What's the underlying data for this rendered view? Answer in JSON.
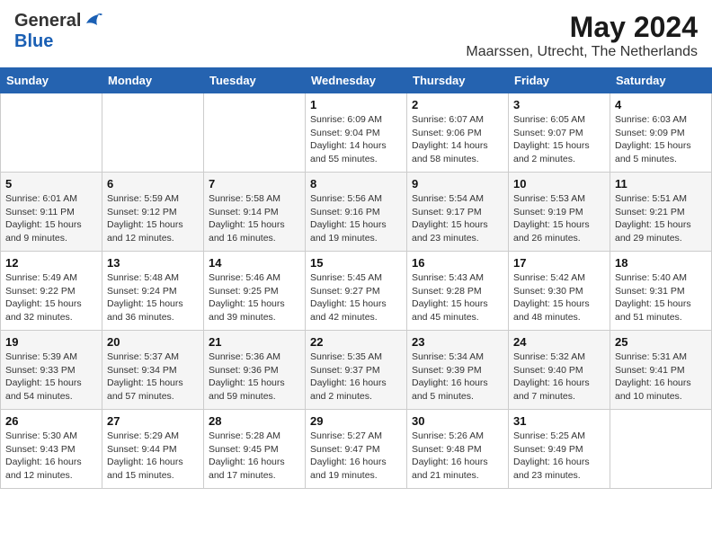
{
  "header": {
    "logo_general": "General",
    "logo_blue": "Blue",
    "month": "May 2024",
    "location": "Maarssen, Utrecht, The Netherlands"
  },
  "days_of_week": [
    "Sunday",
    "Monday",
    "Tuesday",
    "Wednesday",
    "Thursday",
    "Friday",
    "Saturday"
  ],
  "weeks": [
    [
      {
        "day": "",
        "info": ""
      },
      {
        "day": "",
        "info": ""
      },
      {
        "day": "",
        "info": ""
      },
      {
        "day": "1",
        "info": "Sunrise: 6:09 AM\nSunset: 9:04 PM\nDaylight: 14 hours\nand 55 minutes."
      },
      {
        "day": "2",
        "info": "Sunrise: 6:07 AM\nSunset: 9:06 PM\nDaylight: 14 hours\nand 58 minutes."
      },
      {
        "day": "3",
        "info": "Sunrise: 6:05 AM\nSunset: 9:07 PM\nDaylight: 15 hours\nand 2 minutes."
      },
      {
        "day": "4",
        "info": "Sunrise: 6:03 AM\nSunset: 9:09 PM\nDaylight: 15 hours\nand 5 minutes."
      }
    ],
    [
      {
        "day": "5",
        "info": "Sunrise: 6:01 AM\nSunset: 9:11 PM\nDaylight: 15 hours\nand 9 minutes."
      },
      {
        "day": "6",
        "info": "Sunrise: 5:59 AM\nSunset: 9:12 PM\nDaylight: 15 hours\nand 12 minutes."
      },
      {
        "day": "7",
        "info": "Sunrise: 5:58 AM\nSunset: 9:14 PM\nDaylight: 15 hours\nand 16 minutes."
      },
      {
        "day": "8",
        "info": "Sunrise: 5:56 AM\nSunset: 9:16 PM\nDaylight: 15 hours\nand 19 minutes."
      },
      {
        "day": "9",
        "info": "Sunrise: 5:54 AM\nSunset: 9:17 PM\nDaylight: 15 hours\nand 23 minutes."
      },
      {
        "day": "10",
        "info": "Sunrise: 5:53 AM\nSunset: 9:19 PM\nDaylight: 15 hours\nand 26 minutes."
      },
      {
        "day": "11",
        "info": "Sunrise: 5:51 AM\nSunset: 9:21 PM\nDaylight: 15 hours\nand 29 minutes."
      }
    ],
    [
      {
        "day": "12",
        "info": "Sunrise: 5:49 AM\nSunset: 9:22 PM\nDaylight: 15 hours\nand 32 minutes."
      },
      {
        "day": "13",
        "info": "Sunrise: 5:48 AM\nSunset: 9:24 PM\nDaylight: 15 hours\nand 36 minutes."
      },
      {
        "day": "14",
        "info": "Sunrise: 5:46 AM\nSunset: 9:25 PM\nDaylight: 15 hours\nand 39 minutes."
      },
      {
        "day": "15",
        "info": "Sunrise: 5:45 AM\nSunset: 9:27 PM\nDaylight: 15 hours\nand 42 minutes."
      },
      {
        "day": "16",
        "info": "Sunrise: 5:43 AM\nSunset: 9:28 PM\nDaylight: 15 hours\nand 45 minutes."
      },
      {
        "day": "17",
        "info": "Sunrise: 5:42 AM\nSunset: 9:30 PM\nDaylight: 15 hours\nand 48 minutes."
      },
      {
        "day": "18",
        "info": "Sunrise: 5:40 AM\nSunset: 9:31 PM\nDaylight: 15 hours\nand 51 minutes."
      }
    ],
    [
      {
        "day": "19",
        "info": "Sunrise: 5:39 AM\nSunset: 9:33 PM\nDaylight: 15 hours\nand 54 minutes."
      },
      {
        "day": "20",
        "info": "Sunrise: 5:37 AM\nSunset: 9:34 PM\nDaylight: 15 hours\nand 57 minutes."
      },
      {
        "day": "21",
        "info": "Sunrise: 5:36 AM\nSunset: 9:36 PM\nDaylight: 15 hours\nand 59 minutes."
      },
      {
        "day": "22",
        "info": "Sunrise: 5:35 AM\nSunset: 9:37 PM\nDaylight: 16 hours\nand 2 minutes."
      },
      {
        "day": "23",
        "info": "Sunrise: 5:34 AM\nSunset: 9:39 PM\nDaylight: 16 hours\nand 5 minutes."
      },
      {
        "day": "24",
        "info": "Sunrise: 5:32 AM\nSunset: 9:40 PM\nDaylight: 16 hours\nand 7 minutes."
      },
      {
        "day": "25",
        "info": "Sunrise: 5:31 AM\nSunset: 9:41 PM\nDaylight: 16 hours\nand 10 minutes."
      }
    ],
    [
      {
        "day": "26",
        "info": "Sunrise: 5:30 AM\nSunset: 9:43 PM\nDaylight: 16 hours\nand 12 minutes."
      },
      {
        "day": "27",
        "info": "Sunrise: 5:29 AM\nSunset: 9:44 PM\nDaylight: 16 hours\nand 15 minutes."
      },
      {
        "day": "28",
        "info": "Sunrise: 5:28 AM\nSunset: 9:45 PM\nDaylight: 16 hours\nand 17 minutes."
      },
      {
        "day": "29",
        "info": "Sunrise: 5:27 AM\nSunset: 9:47 PM\nDaylight: 16 hours\nand 19 minutes."
      },
      {
        "day": "30",
        "info": "Sunrise: 5:26 AM\nSunset: 9:48 PM\nDaylight: 16 hours\nand 21 minutes."
      },
      {
        "day": "31",
        "info": "Sunrise: 5:25 AM\nSunset: 9:49 PM\nDaylight: 16 hours\nand 23 minutes."
      },
      {
        "day": "",
        "info": ""
      }
    ]
  ]
}
